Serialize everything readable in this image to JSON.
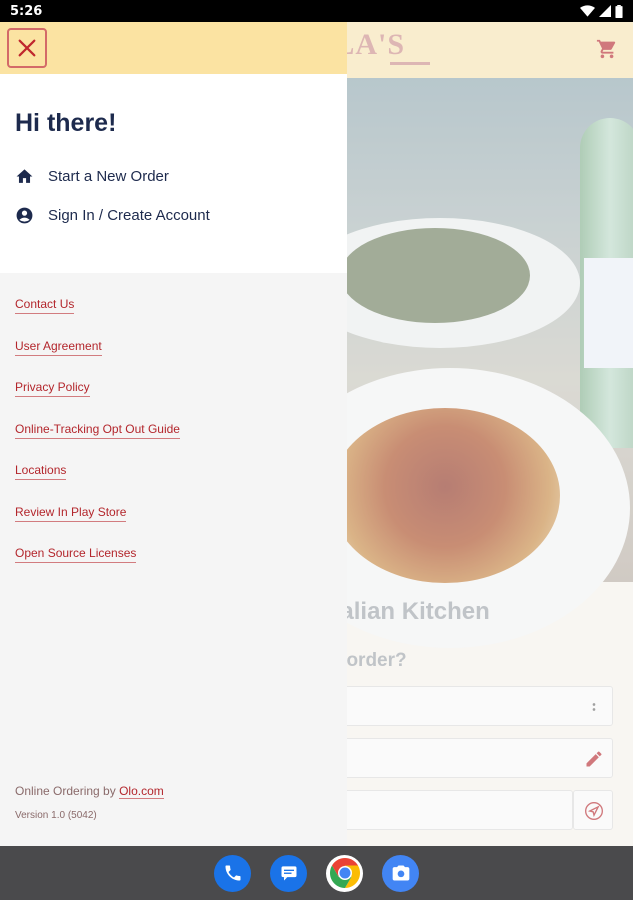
{
  "status_bar": {
    "time": "5:26",
    "icons": [
      "wifi-icon",
      "signal-icon",
      "battery-icon"
    ]
  },
  "background_app": {
    "logo_text": "OLA'S",
    "cart_icon": "cart-icon",
    "restaurant_title": "'s Italian Kitchen",
    "question": "your order?",
    "field_icons": [
      "more-vert-icon",
      "pencil-icon",
      "navigation-icon"
    ]
  },
  "drawer": {
    "close_icon": "close-icon",
    "greeting": "Hi there!",
    "menu": [
      {
        "label": "Start a New Order",
        "icon": "home-icon"
      },
      {
        "label": "Sign In / Create Account",
        "icon": "account-circle-icon"
      }
    ],
    "links": [
      "Contact Us",
      "User Agreement",
      "Privacy Policy",
      "Online-Tracking Opt Out Guide",
      "Locations",
      "Review In Play Store",
      "Open Source Licenses"
    ],
    "footer_prefix": "Online Ordering by ",
    "footer_link": "Olo.com",
    "version": "Version 1.0 (5042)"
  },
  "dock": {
    "apps": [
      "phone-icon",
      "messages-icon",
      "chrome-icon",
      "camera-icon"
    ]
  },
  "colors": {
    "accent_red": "#b3262c",
    "navy": "#1d2a4d",
    "header_yellow": "#fbe3a2"
  }
}
